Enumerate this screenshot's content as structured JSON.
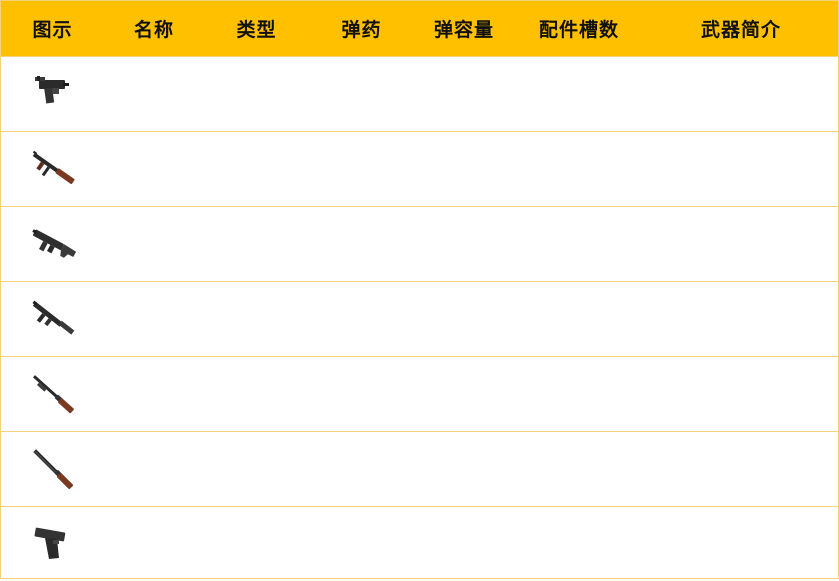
{
  "header": {
    "columns": [
      "图示",
      "名称",
      "类型",
      "弹药",
      "弹容量",
      "配件槽数",
      "武器简介"
    ]
  },
  "rows": [
    {
      "icon": "micro-uzi-icon",
      "name": "",
      "type": "",
      "ammo": "",
      "capacity": "",
      "slots": "",
      "intro": ""
    },
    {
      "icon": "tommy-gun-icon",
      "name": "",
      "type": "",
      "ammo": "",
      "capacity": "",
      "slots": "",
      "intro": ""
    },
    {
      "icon": "ump-icon",
      "name": "",
      "type": "",
      "ammo": "",
      "capacity": "",
      "slots": "",
      "intro": ""
    },
    {
      "icon": "vector-icon",
      "name": "",
      "type": "",
      "ammo": "",
      "capacity": "",
      "slots": "",
      "intro": ""
    },
    {
      "icon": "pump-shotgun-icon",
      "name": "",
      "type": "",
      "ammo": "",
      "capacity": "",
      "slots": "",
      "intro": ""
    },
    {
      "icon": "double-barrel-shotgun-icon",
      "name": "",
      "type": "",
      "ammo": "",
      "capacity": "",
      "slots": "",
      "intro": ""
    },
    {
      "icon": "pistol-icon",
      "name": "",
      "type": "",
      "ammo": "",
      "capacity": "",
      "slots": "",
      "intro": ""
    }
  ],
  "colors": {
    "header_bg": "#ffc000",
    "border": "#f4d27a",
    "header_text": "#111111"
  }
}
